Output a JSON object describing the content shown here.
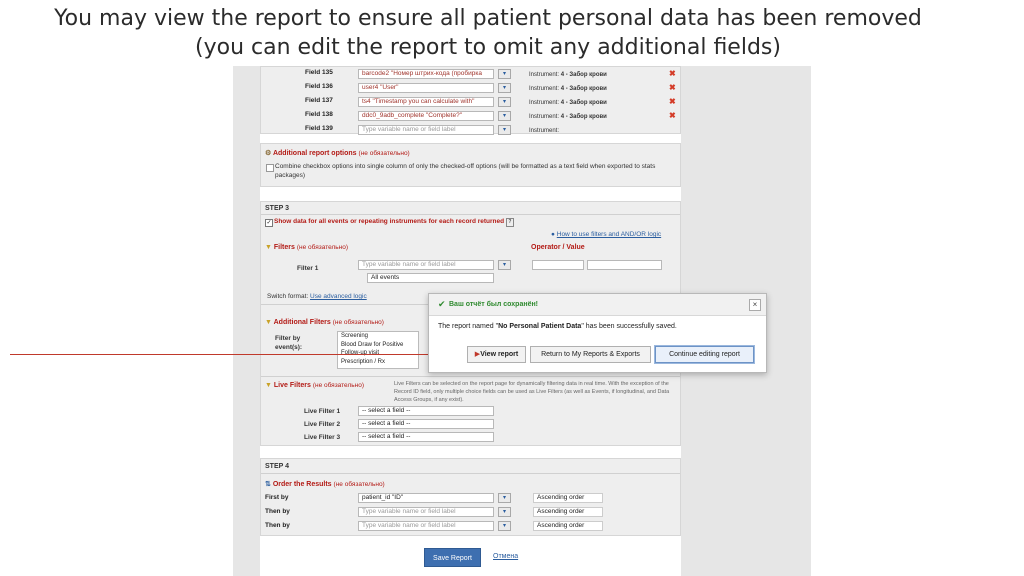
{
  "slide_title": "You may view the report to ensure all patient personal data has been removed (you can edit the report to omit any additional fields)",
  "fields": [
    {
      "label": "Field 135",
      "value": "barcode2 \"Номер штрих-кода (пробирка",
      "instrument_label": "Instrument:",
      "instrument": "4 - Забор крови",
      "placeholder": false
    },
    {
      "label": "Field 136",
      "value": "user4 \"User\"",
      "instrument_label": "Instrument:",
      "instrument": "4 - Забор крови",
      "placeholder": false
    },
    {
      "label": "Field 137",
      "value": "ts4 \"Timestamp you can calculate with\"",
      "instrument_label": "Instrument:",
      "instrument": "4 - Забор крови",
      "placeholder": false
    },
    {
      "label": "Field 138",
      "value": "ddc0_9adb_complete \"Complete?\"",
      "instrument_label": "Instrument:",
      "instrument": "4 - Забор крови",
      "placeholder": false
    },
    {
      "label": "Field 139",
      "value": "Type variable name or field label",
      "instrument_label": "Instrument:",
      "instrument": "",
      "placeholder": true
    }
  ],
  "additional_options": {
    "title": "Additional report options",
    "optional": "(не обязательно)",
    "checkbox_text": "Combine checkbox options into single column of only the checked-off options (will be formatted as a text field when exported to stats packages)"
  },
  "step3": {
    "label": "STEP 3",
    "show_data": "Show data for all events or repeating instruments for each record returned",
    "help_link": "How to use filters and AND/OR logic",
    "filters_title": "Filters",
    "filters_optional": "(не обязательно)",
    "operator_header": "Operator / Value",
    "filter1_label": "Filter 1",
    "filter1_placeholder": "Type variable name or field label",
    "all_events": "All events",
    "switch_format": "Switch format:",
    "switch_link": "Use advanced logic",
    "additional_filters_title": "Additional Filters",
    "additional_filters_optional": "(не обязательно)",
    "filter_by_event": "Filter by event(s):",
    "events": [
      "Screening",
      "Blood Draw for Positive",
      "Follow-up visit",
      "Prescription / Rx"
    ],
    "live_filters_title": "Live Filters",
    "live_filters_optional": "(не обязательно)",
    "live_filters_desc": "Live Filters can be selected on the report page for dynamically filtering data in real time. With the exception of the Record ID field, only multiple choice fields can be used as Live Filters (as well as Events, if longitudinal, and Data Access Groups, if any exist).",
    "live_filters": [
      {
        "label": "Live Filter 1",
        "value": "-- select a field --"
      },
      {
        "label": "Live Filter 2",
        "value": "-- select a field --"
      },
      {
        "label": "Live Filter 3",
        "value": "-- select a field --"
      }
    ]
  },
  "step4": {
    "label": "STEP 4",
    "order_title": "Order the Results",
    "order_optional": "(не обязательно)",
    "rows": [
      {
        "label": "First by",
        "value": "patient_id \"ID\"",
        "order": "Ascending order",
        "placeholder": false
      },
      {
        "label": "Then by",
        "value": "Type variable name or field label",
        "order": "Ascending order",
        "placeholder": true
      },
      {
        "label": "Then by",
        "value": "Type variable name or field label",
        "order": "Ascending order",
        "placeholder": true
      }
    ]
  },
  "footer": {
    "save": "Save Report",
    "cancel": "Отмена"
  },
  "modal": {
    "title": "Ваш отчёт был сохранён!",
    "message_pre": "The report named \"",
    "report_name": "No Personal Patient Data",
    "message_post": "\" has been successfully saved.",
    "view_report": "View report",
    "return": "Return to My Reports & Exports",
    "continue": "Continue editing report",
    "close": "×"
  },
  "colors": {
    "accent_red": "#b31b16",
    "link_blue": "#2a5d9f",
    "save_button": "#3e6fb0",
    "success_green": "#2f8a2f",
    "arrow": "#c0392b"
  }
}
